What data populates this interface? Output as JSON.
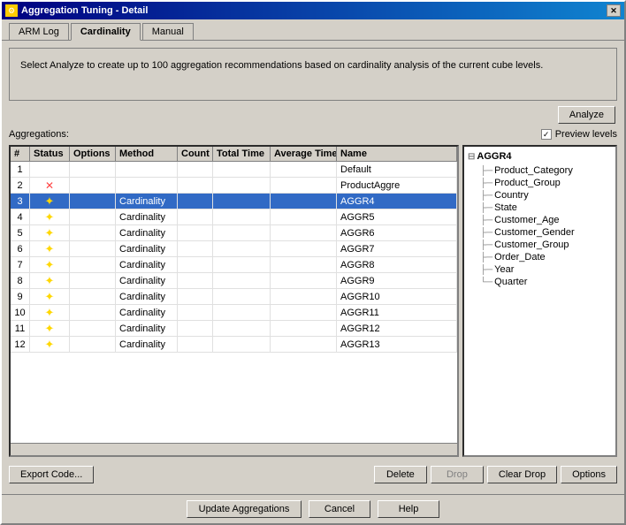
{
  "window": {
    "title": "Aggregation Tuning - Detail",
    "close_label": "✕"
  },
  "tabs": [
    {
      "id": "arm-log",
      "label": "ARM Log"
    },
    {
      "id": "cardinality",
      "label": "Cardinality",
      "active": true
    },
    {
      "id": "manual",
      "label": "Manual"
    }
  ],
  "info_text": "Select Analyze to create up to 100 aggregation recommendations based on cardinality analysis of the current cube levels.",
  "analyze_button": "Analyze",
  "aggregations_label": "Aggregations:",
  "preview_levels_label": "Preview levels",
  "table": {
    "headers": [
      "#",
      "Status",
      "Options",
      "Method",
      "Count",
      "Total Time",
      "Average Time",
      "Name"
    ],
    "rows": [
      {
        "num": "1",
        "status": "",
        "options": "",
        "method": "",
        "count": "",
        "total_time": "",
        "avg_time": "",
        "name": "Default"
      },
      {
        "num": "2",
        "status": "x",
        "options": "",
        "method": "",
        "count": "",
        "total_time": "",
        "avg_time": "",
        "name": "ProductAggre"
      },
      {
        "num": "3",
        "status": "star",
        "options": "",
        "method": "Cardinality",
        "count": "",
        "total_time": "",
        "avg_time": "",
        "name": "AGGR4",
        "selected": true
      },
      {
        "num": "4",
        "status": "star",
        "options": "",
        "method": "Cardinality",
        "count": "",
        "total_time": "",
        "avg_time": "",
        "name": "AGGR5"
      },
      {
        "num": "5",
        "status": "star",
        "options": "",
        "method": "Cardinality",
        "count": "",
        "total_time": "",
        "avg_time": "",
        "name": "AGGR6"
      },
      {
        "num": "6",
        "status": "star",
        "options": "",
        "method": "Cardinality",
        "count": "",
        "total_time": "",
        "avg_time": "",
        "name": "AGGR7"
      },
      {
        "num": "7",
        "status": "star",
        "options": "",
        "method": "Cardinality",
        "count": "",
        "total_time": "",
        "avg_time": "",
        "name": "AGGR8"
      },
      {
        "num": "8",
        "status": "star",
        "options": "",
        "method": "Cardinality",
        "count": "",
        "total_time": "",
        "avg_time": "",
        "name": "AGGR9"
      },
      {
        "num": "9",
        "status": "star",
        "options": "",
        "method": "Cardinality",
        "count": "",
        "total_time": "",
        "avg_time": "",
        "name": "AGGR10"
      },
      {
        "num": "10",
        "status": "star",
        "options": "",
        "method": "Cardinality",
        "count": "",
        "total_time": "",
        "avg_time": "",
        "name": "AGGR11"
      },
      {
        "num": "11",
        "status": "star",
        "options": "",
        "method": "Cardinality",
        "count": "",
        "total_time": "",
        "avg_time": "",
        "name": "AGGR12"
      },
      {
        "num": "12",
        "status": "star",
        "options": "",
        "method": "Cardinality",
        "count": "",
        "total_time": "",
        "avg_time": "",
        "name": "AGGR13"
      }
    ]
  },
  "tree": {
    "root": "AGGR4",
    "children": [
      "Product_Category",
      "Product_Group",
      "Country",
      "State",
      "Customer_Age",
      "Customer_Gender",
      "Customer_Group",
      "Order_Date",
      "Year",
      "Quarter"
    ]
  },
  "buttons": {
    "export_code": "Export Code...",
    "delete": "Delete",
    "drop": "Drop",
    "clear_drop": "Clear Drop",
    "options": "Options",
    "update_aggregations": "Update Aggregations",
    "cancel": "Cancel",
    "help": "Help"
  }
}
